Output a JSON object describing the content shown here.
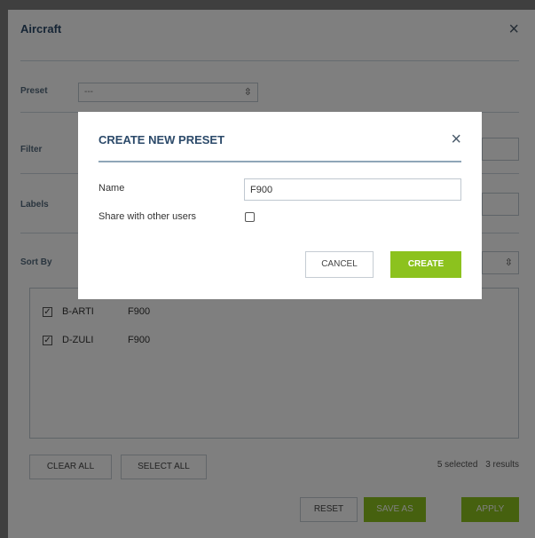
{
  "panel": {
    "title": "Aircraft",
    "preset_label": "Preset",
    "preset_value": "---",
    "filter_label": "Filter",
    "labels_label": "Labels",
    "sort_label": "Sort By",
    "items": [
      {
        "reg": "B-ARTI",
        "type": "F900",
        "checked": true
      },
      {
        "reg": "D-ZULI",
        "type": "F900",
        "checked": true
      }
    ],
    "clear_all": "CLEAR ALL",
    "select_all": "SELECT ALL",
    "selected_count": "5 selected",
    "results_count": "3 results",
    "reset": "RESET",
    "save_as": "SAVE AS",
    "apply": "APPLY"
  },
  "modal": {
    "title": "CREATE NEW PRESET",
    "name_label": "Name",
    "name_value": "F900",
    "share_label": "Share with other users",
    "cancel": "CANCEL",
    "create": "CREATE"
  },
  "colors": {
    "accent_green": "#8cc21e",
    "title_blue": "#2c4a6a"
  }
}
